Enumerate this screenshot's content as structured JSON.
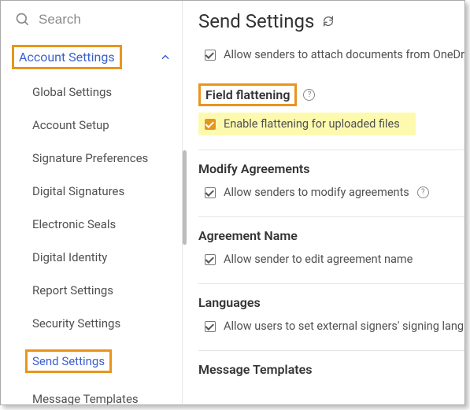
{
  "search": {
    "placeholder": "Search"
  },
  "sidebar": {
    "header": "Account Settings",
    "items": [
      {
        "label": "Global Settings"
      },
      {
        "label": "Account Setup"
      },
      {
        "label": "Signature Preferences"
      },
      {
        "label": "Digital Signatures"
      },
      {
        "label": "Electronic Seals"
      },
      {
        "label": "Digital Identity"
      },
      {
        "label": "Report Settings"
      },
      {
        "label": "Security Settings"
      },
      {
        "label": "Send Settings"
      },
      {
        "label": "Message Templates"
      }
    ]
  },
  "page": {
    "title": "Send Settings",
    "top_option": "Allow senders to attach documents from OneDrive",
    "sections": [
      {
        "heading": "Field flattening",
        "option": "Enable flattening for uploaded files"
      },
      {
        "heading": "Modify Agreements",
        "option": "Allow senders to modify agreements"
      },
      {
        "heading": "Agreement Name",
        "option": "Allow sender to edit agreement name"
      },
      {
        "heading": "Languages",
        "option": "Allow users to set external signers' signing language"
      },
      {
        "heading": "Message Templates"
      }
    ]
  }
}
